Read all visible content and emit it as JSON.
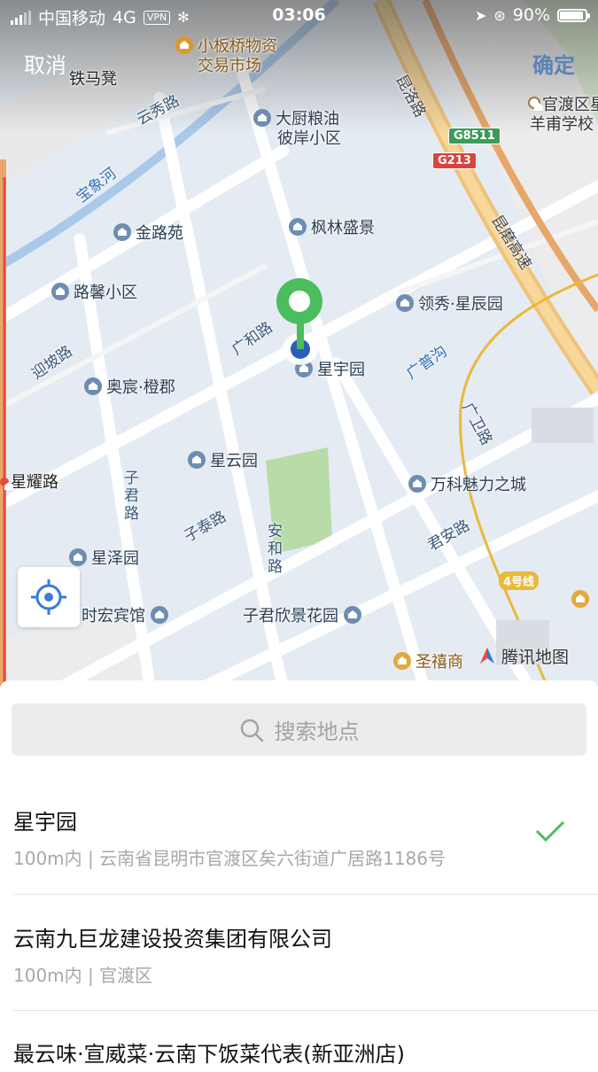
{
  "status_bar": {
    "carrier": "中国移动",
    "network": "4G",
    "vpn": "VPN",
    "time": "03:06",
    "battery": "90%"
  },
  "header": {
    "cancel": "取消",
    "confirm": "确定"
  },
  "map": {
    "places": {
      "xiaobanqiao": "小板桥物资",
      "xiaobanqiao2": "交易市场",
      "tiemadeng": "铁马凳",
      "dachu": "大厨粮油",
      "dachu2": "彼岸小区",
      "guandu": "官渡区星",
      "guandu2": "羊甫学校",
      "jinluyuan": "金路苑",
      "fenglin": "枫林盛景",
      "luxin": "路馨小区",
      "lingxiu": "领秀·星辰园",
      "xingyuyuan": "星宇园",
      "aochen": "奥宸·橙郡",
      "xingyunyuan": "星云园",
      "wanke": "万科魅力之城",
      "xingzeyuan": "星泽园",
      "shihong": "时宏宾馆",
      "zijun_xinjing": "子君欣景花园",
      "shengxi": "圣禧商",
      "xingyaolu": "星耀路"
    },
    "roads": {
      "yunxiu": "云秀路",
      "kunluo": "昆洛路",
      "kunmo": "昆磨高速",
      "guanghe": "广和路",
      "yingpo": "迎坡路",
      "guangwei": "广卫路",
      "zijun": "子君路",
      "zitai": "子泰路",
      "anhe": "安和路",
      "junan": "君安路"
    },
    "rivers": {
      "baoxiang": "宝象河",
      "guangpu": "广普沟"
    },
    "shields": {
      "g8511": "G8511",
      "g213": "G213",
      "line4": "4号线"
    },
    "logo": "腾讯地图"
  },
  "search": {
    "placeholder": "搜索地点"
  },
  "results": [
    {
      "name": "星宇园",
      "address": "100m内 | 云南省昆明市官渡区矣六街道广居路1186号",
      "selected": true
    },
    {
      "name": "云南九巨龙建设投资集团有限公司",
      "address": "100m内 | 官渡区"
    },
    {
      "name": "最云味·宣威菜·云南下饭菜代表(新亚洲店)"
    }
  ],
  "colors": {
    "accent_green": "#4cbd5e",
    "pin_blue": "#2b5fb7",
    "confirm_blue": "#5a83b5"
  }
}
